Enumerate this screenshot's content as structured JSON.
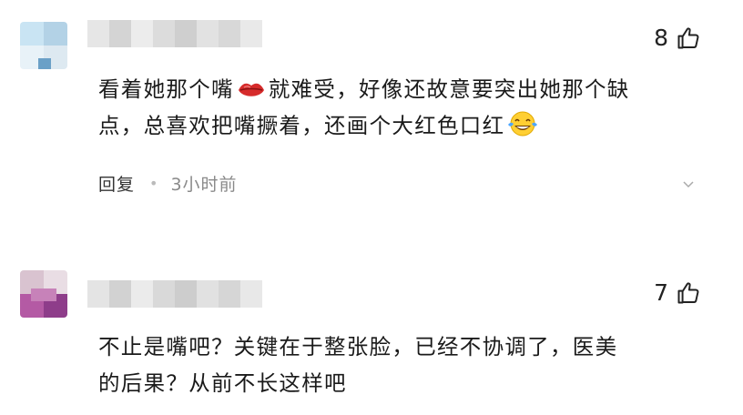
{
  "comments": [
    {
      "likes": "8",
      "text_line1_part1": "看着她那个嘴",
      "text_line1_part2": "就难受，好像还故意要突出她那个缺",
      "text_line2": "点，总喜欢把嘴撅着，还画个大红色口红",
      "emoji_lips": "lips-emoji",
      "emoji_laugh": "crying-laughing-emoji",
      "reply_label": "回复",
      "time": "3小时前"
    },
    {
      "likes": "7",
      "text_line1": "不止是嘴吧？关键在于整张脸，已经不协调了，医美",
      "text_line2": "的后果？从前不长这样吧"
    }
  ],
  "colors": {
    "text": "#1a1a1a",
    "meta_text": "#8a8a8a",
    "lips_red": "#d62b2b"
  }
}
